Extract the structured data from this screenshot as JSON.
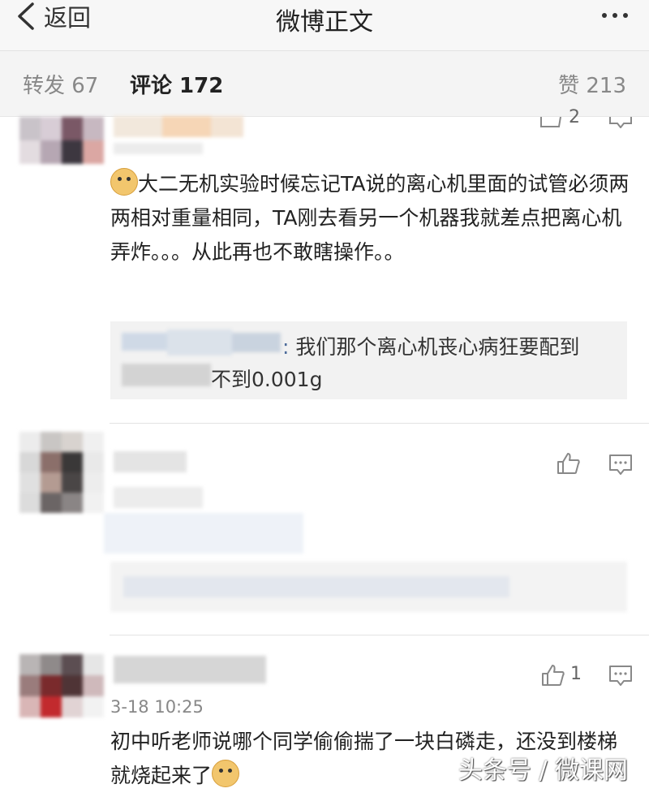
{
  "nav": {
    "back_label": "返回",
    "title": "微博正文"
  },
  "tabs": {
    "repost": "转发 67",
    "comments": "评论 172",
    "likes": "赞 213"
  },
  "comment1": {
    "likes": "2",
    "text": "大二无机实验时候忘记TA说的离心机里面的试管必须两两相对重量相同，TA刚去看另一个机器我就差点把离心机弄炸。。。从此再也不敢瞎操作。。",
    "reply_text_line1": "我们那个离心机丧心病狂要配到",
    "reply_text_line2": "不到0.001g"
  },
  "comment3": {
    "timestamp": "3-18 10:25",
    "likes": "1",
    "text": "初中听老师说哪个同学偷偷揣了一块白磷走，还没到楼梯就烧起来了"
  },
  "watermark": "头条号 / 微课网",
  "icons": [
    "chevron-left-icon",
    "more-icon",
    "thumbs-up-icon",
    "comment-icon",
    "doge-emoji-icon"
  ]
}
